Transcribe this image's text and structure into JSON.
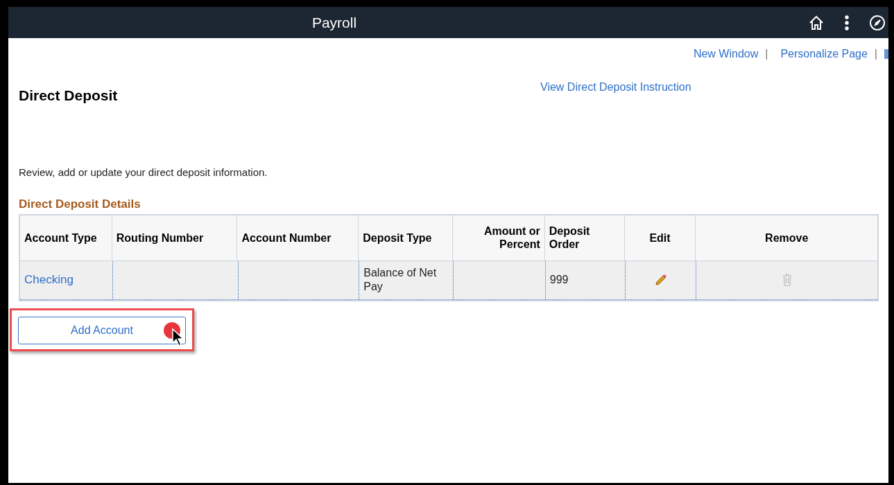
{
  "header": {
    "title": "Payroll"
  },
  "top_links": [
    {
      "label": "New Window",
      "separator": "|"
    },
    {
      "label": "Personalize Page",
      "separator": "|"
    }
  ],
  "page": {
    "title": "Direct Deposit",
    "instruction_link": "View Direct Deposit Instruction",
    "intro": "Review, add or update your direct deposit information."
  },
  "grid": {
    "title": "Direct Deposit Details",
    "columns": [
      "Account Type",
      "Routing Number",
      "Account Number",
      "Deposit Type",
      "Amount or Percent",
      "Deposit Order",
      "Edit",
      "Remove"
    ],
    "rows": [
      {
        "account_type": "Checking",
        "deposit_type": "Balance of Net Pay",
        "deposit_order": "999",
        "remove_disabled": true
      }
    ]
  },
  "add_button": {
    "label": "Add Account",
    "highlighted": true
  }
}
